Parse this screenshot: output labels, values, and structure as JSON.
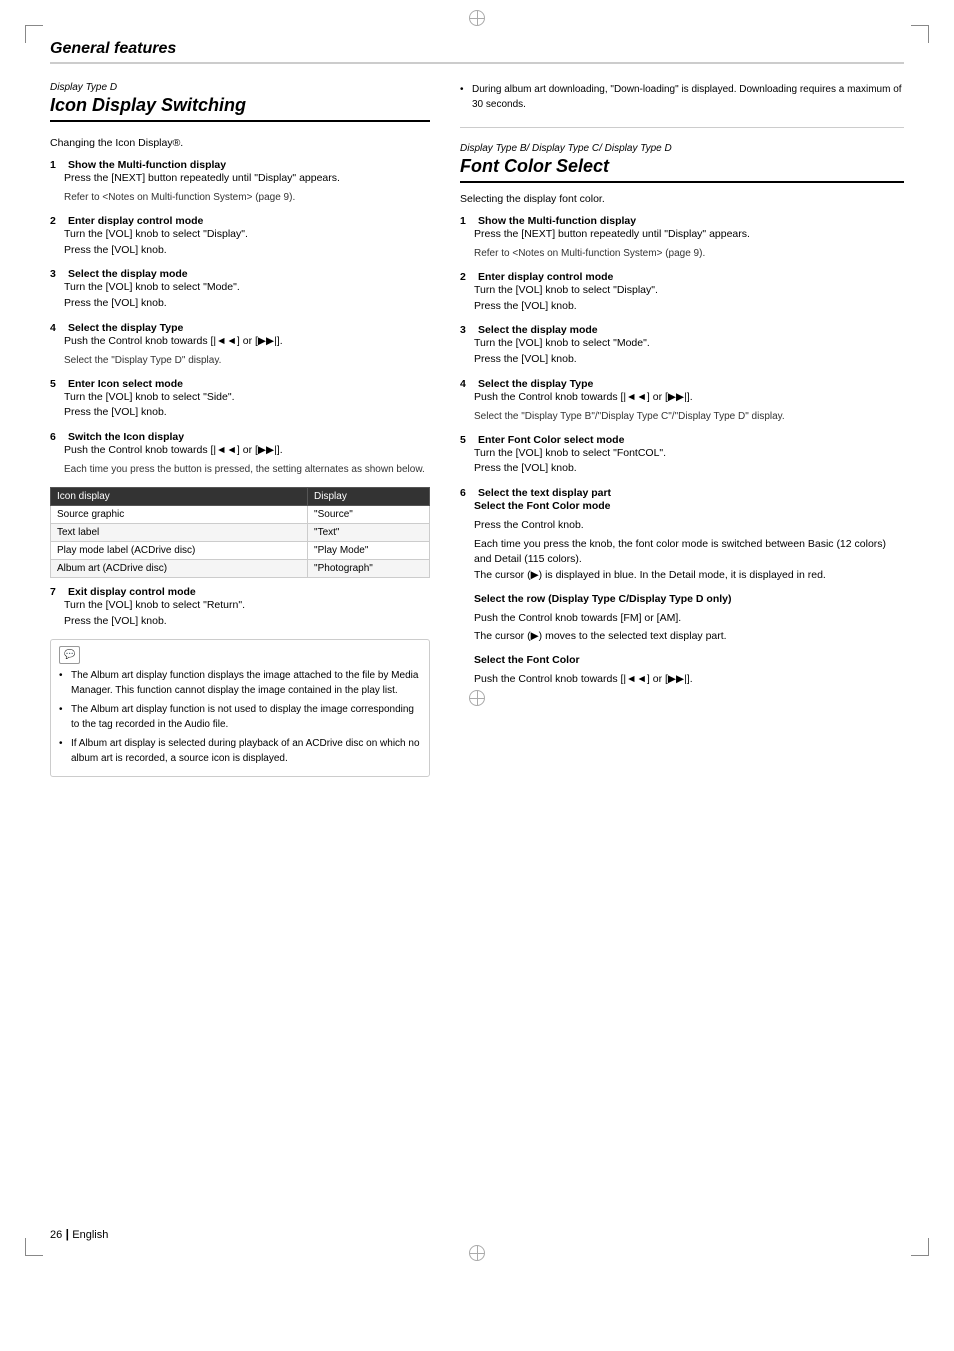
{
  "page": {
    "title": "General features",
    "footer_page": "26",
    "footer_lang": "English"
  },
  "left_section": {
    "italic_label": "Display Type D",
    "title": "Icon Display Switching",
    "subtitle": "Changing the Icon Display®.",
    "steps": [
      {
        "num": "1",
        "title": "Show the Multi-function display",
        "body": "Press the [NEXT] button repeatedly until \"Display\" appears.",
        "note": "Refer to <Notes on Multi-function System> (page 9)."
      },
      {
        "num": "2",
        "title": "Enter display control mode",
        "body": "Turn the [VOL] knob to select \"Display\".\nPress the [VOL] knob."
      },
      {
        "num": "3",
        "title": "Select the display mode",
        "body": "Turn the [VOL] knob to select \"Mode\".\nPress the [VOL] knob."
      },
      {
        "num": "4",
        "title": "Select the display Type",
        "body": "Push the Control knob towards [|◄◄] or [▶▶|].",
        "note": "Select the \"Display Type D\" display."
      },
      {
        "num": "5",
        "title": "Enter Icon select mode",
        "body": "Turn the [VOL] knob to select \"Side\".\nPress the [VOL] knob."
      },
      {
        "num": "6",
        "title": "Switch the Icon display",
        "body": "Push the Control knob towards [|◄◄] or [▶▶|].",
        "note": "Each time you press the button is pressed, the setting alternates as shown below."
      },
      {
        "num": "7",
        "title": "Exit display control mode",
        "body": "Turn the [VOL] knob to select \"Return\".\nPress the [VOL] knob."
      }
    ],
    "table": {
      "headers": [
        "Icon display",
        "Display"
      ],
      "rows": [
        [
          "Source graphic",
          "\"Source\""
        ],
        [
          "Text label",
          "\"Text\""
        ],
        [
          "Play mode label (ACDrive disc)",
          "\"Play Mode\""
        ],
        [
          "Album art (ACDrive disc)",
          "\"Photograph\""
        ]
      ]
    },
    "note_box": {
      "items": [
        "The Album art display function displays the image attached to the file by Media Manager. This function cannot display the image contained in the play list.",
        "The Album art display function is not used to display the image corresponding to the tag recorded in the Audio file.",
        "If Album art display is selected during playback of an ACDrive disc on which no album art is recorded, a source icon is displayed."
      ]
    }
  },
  "right_section": {
    "top_note": "During album art downloading, \"Down-loading\" is displayed. Downloading requires a maximum of 30 seconds.",
    "italic_label": "Display Type B/ Display Type C/ Display Type D",
    "title": "Font Color Select",
    "subtitle": "Selecting the display font color.",
    "steps": [
      {
        "num": "1",
        "title": "Show the Multi-function display",
        "body": "Press the [NEXT] button repeatedly until \"Display\" appears.",
        "note": "Refer to <Notes on Multi-function System> (page 9)."
      },
      {
        "num": "2",
        "title": "Enter display control mode",
        "body": "Turn the [VOL] knob to select \"Display\".\nPress the [VOL] knob."
      },
      {
        "num": "3",
        "title": "Select the display mode",
        "body": "Turn the [VOL] knob to select \"Mode\".\nPress the [VOL] knob."
      },
      {
        "num": "4",
        "title": "Select the display Type",
        "body": "Push the Control knob towards [|◄◄] or [▶▶|].",
        "note": "Select the \"Display Type B\"/\"Display Type C\"/\"Display Type D\" display."
      },
      {
        "num": "5",
        "title": "Enter Font Color select mode",
        "body": "Turn the [VOL] knob to select \"FontCOL\".\nPress the [VOL] knob."
      },
      {
        "num": "6",
        "title": "Select the text display part"
      }
    ],
    "step6_sub": [
      {
        "subtitle": "Select the Font Color mode",
        "body": "Press the Control knob.",
        "detail": "Each time you press the knob, the font color mode is switched between Basic (12 colors) and Detail (115 colors).\nThe cursor (▶) is displayed in blue. In the Detail mode, it is displayed in red."
      },
      {
        "subtitle": "Select the row (Display Type C/Display Type D only)",
        "body": "Push the Control knob towards [FM] or [AM].",
        "detail": "The cursor (▶) moves to the selected text display part."
      },
      {
        "subtitle": "Select the Font Color",
        "body": "Push the Control knob towards [|◄◄] or [▶▶|]."
      }
    ]
  }
}
